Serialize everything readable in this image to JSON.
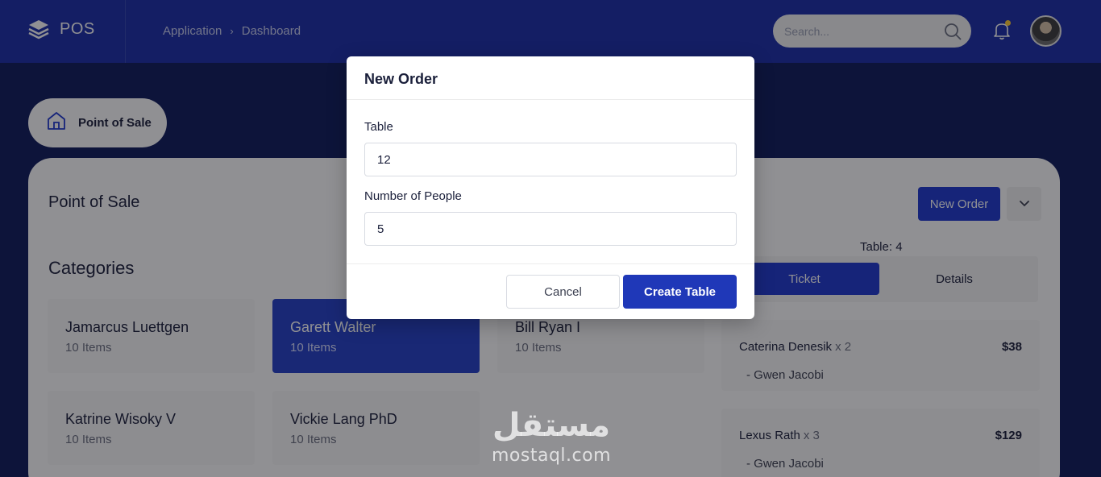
{
  "app": {
    "brand": "POS",
    "breadcrumb": [
      "Application",
      "Dashboard"
    ]
  },
  "header": {
    "search_placeholder": "Search...",
    "accent": "#1a2da8",
    "notification_dot": "#ffcc33"
  },
  "nav": {
    "pos_tab_label": "Point of Sale"
  },
  "main": {
    "title": "Point of Sale",
    "categories_title": "Categories",
    "categories": [
      {
        "name": "Jamarcus Luettgen",
        "count": "10 Items",
        "active": false
      },
      {
        "name": "Garett Walter",
        "count": "10 Items",
        "active": true
      },
      {
        "name": "Bill Ryan I",
        "count": "10 Items",
        "active": false
      },
      {
        "name": "Katrine Wisoky V",
        "count": "10 Items",
        "active": false
      },
      {
        "name": "Vickie Lang PhD",
        "count": "10 Items",
        "active": false
      }
    ]
  },
  "order_panel": {
    "new_order_label": "New Order",
    "table_label": "Table: 4",
    "tabs": [
      "Ticket",
      "Details"
    ],
    "items": [
      {
        "name": "Caterina Denesik",
        "qty": "x 2",
        "price": "$38",
        "modifier": "- Gwen Jacobi"
      },
      {
        "name": "Lexus Rath",
        "qty": "x 3",
        "price": "$129",
        "modifier": "- Gwen Jacobi"
      }
    ]
  },
  "modal": {
    "title": "New Order",
    "table_label": "Table",
    "table_value": "12",
    "people_label": "Number of People",
    "people_value": "5",
    "cancel_label": "Cancel",
    "create_label": "Create Table",
    "primary_color": "#1f38b8"
  },
  "watermark": {
    "arabic": "مستقل",
    "latin": "mostaql.com"
  }
}
